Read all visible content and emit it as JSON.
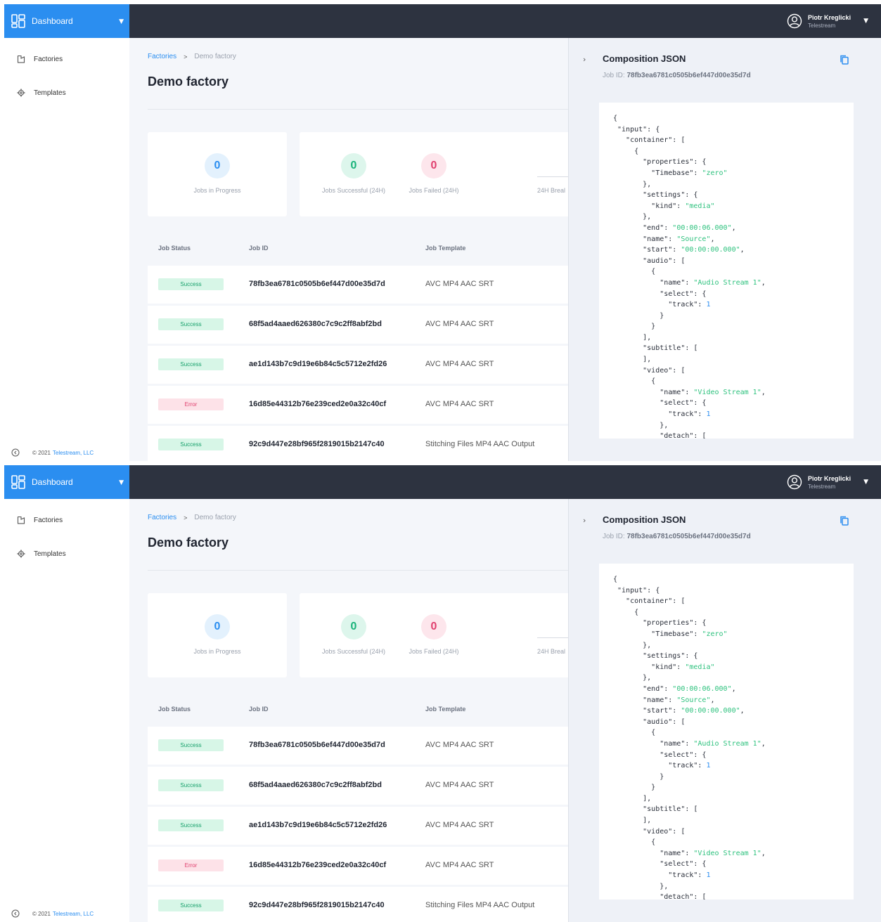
{
  "topbar": {
    "brand_label": "Dashboard",
    "user_name": "Piotr Kreglicki",
    "user_org": "Telestream"
  },
  "sidebar": {
    "items": [
      {
        "label": "Factories",
        "icon": "factory-icon"
      },
      {
        "label": "Templates",
        "icon": "gear-icon"
      }
    ],
    "copyright_prefix": "© 2021",
    "copyright_link": "Telestream, LLC"
  },
  "breadcrumb": {
    "parent": "Factories",
    "separator": ">",
    "current": "Demo factory"
  },
  "page": {
    "title": "Demo factory"
  },
  "stats": {
    "in_progress": {
      "value": "0",
      "label": "Jobs in Progress"
    },
    "successful": {
      "value": "0",
      "label": "Jobs Successful (24H)"
    },
    "failed": {
      "value": "0",
      "label": "Jobs Failed (24H)"
    },
    "breakdown_label": "24H Breal"
  },
  "table": {
    "headers": {
      "status": "Job Status",
      "id": "Job ID",
      "template": "Job Template"
    },
    "rows": [
      {
        "status": "Success",
        "id": "78fb3ea6781c0505b6ef447d00e35d7d",
        "template": "AVC MP4 AAC SRT"
      },
      {
        "status": "Success",
        "id": "68f5ad4aaed626380c7c9c2ff8abf2bd",
        "template": "AVC MP4 AAC SRT"
      },
      {
        "status": "Success",
        "id": "ae1d143b7c9d19e6b84c5c5712e2fd26",
        "template": "AVC MP4 AAC SRT"
      },
      {
        "status": "Error",
        "id": "16d85e44312b76e239ced2e0a32c40cf",
        "template": "AVC MP4 AAC SRT"
      },
      {
        "status": "Success",
        "id": "92c9d447e28bf965f2819015b2147c40",
        "template": "Stitching Files MP4 AAC Output"
      }
    ]
  },
  "panel": {
    "title": "Composition JSON",
    "job_prefix": "Job ID:",
    "job_id": "78fb3ea6781c0505b6ef447d00e35d7d",
    "json_lines": [
      [
        {
          "t": "{"
        }
      ],
      [
        {
          "t": " \"input\": {"
        }
      ],
      [
        {
          "t": "   \"container\": ["
        }
      ],
      [
        {
          "t": "     {"
        }
      ],
      [
        {
          "t": "       \"properties\": {"
        }
      ],
      [
        {
          "t": "         \"Timebase\": "
        },
        {
          "t": "\"zero\"",
          "c": "jv"
        }
      ],
      [
        {
          "t": "       },"
        }
      ],
      [
        {
          "t": "       \"settings\": {"
        }
      ],
      [
        {
          "t": "         \"kind\": "
        },
        {
          "t": "\"media\"",
          "c": "jv"
        }
      ],
      [
        {
          "t": "       },"
        }
      ],
      [
        {
          "t": "       \"end\": "
        },
        {
          "t": "\"00:00:06.000\"",
          "c": "jv"
        },
        {
          "t": ","
        }
      ],
      [
        {
          "t": "       \"name\": "
        },
        {
          "t": "\"Source\"",
          "c": "jv"
        },
        {
          "t": ","
        }
      ],
      [
        {
          "t": "       \"start\": "
        },
        {
          "t": "\"00:00:00.000\"",
          "c": "jv"
        },
        {
          "t": ","
        }
      ],
      [
        {
          "t": "       \"audio\": ["
        }
      ],
      [
        {
          "t": "         {"
        }
      ],
      [
        {
          "t": "           \"name\": "
        },
        {
          "t": "\"Audio Stream 1\"",
          "c": "jv"
        },
        {
          "t": ","
        }
      ],
      [
        {
          "t": "           \"select\": {"
        }
      ],
      [
        {
          "t": "             \"track\": "
        },
        {
          "t": "1",
          "c": "jn"
        }
      ],
      [
        {
          "t": "           }"
        }
      ],
      [
        {
          "t": "         }"
        }
      ],
      [
        {
          "t": "       ],"
        }
      ],
      [
        {
          "t": "       \"subtitle\": ["
        }
      ],
      [
        {
          "t": "       ],"
        }
      ],
      [
        {
          "t": "       \"video\": ["
        }
      ],
      [
        {
          "t": "         {"
        }
      ],
      [
        {
          "t": "           \"name\": "
        },
        {
          "t": "\"Video Stream 1\"",
          "c": "jv"
        },
        {
          "t": ","
        }
      ],
      [
        {
          "t": "           \"select\": {"
        }
      ],
      [
        {
          "t": "             \"track\": "
        },
        {
          "t": "1",
          "c": "jn"
        }
      ],
      [
        {
          "t": "           },"
        }
      ],
      [
        {
          "t": "           \"detach\": ["
        }
      ]
    ]
  },
  "colors": {
    "brand": "#2b8ef0",
    "topbar": "#2d3340",
    "success": "#17a06b",
    "error": "#e0406e"
  }
}
